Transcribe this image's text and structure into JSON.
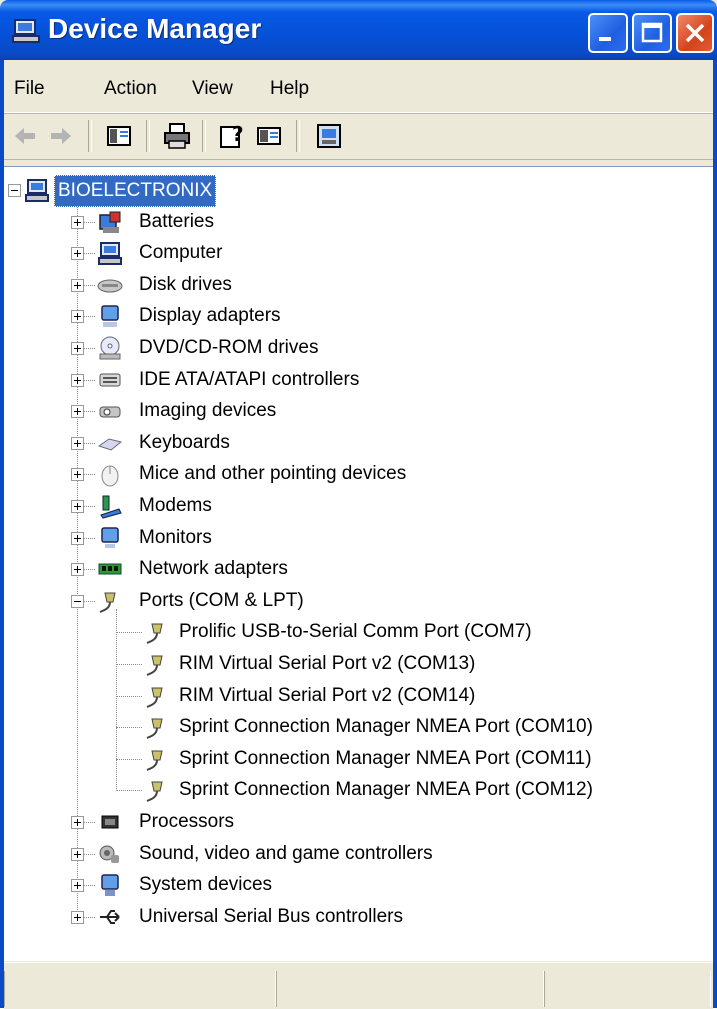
{
  "window": {
    "title": "Device Manager",
    "title_icon": "computer-icon",
    "controls": [
      "minimize",
      "maximize",
      "close"
    ],
    "accent_color": "#0a4ac6"
  },
  "menu": {
    "items": [
      "File",
      "Action",
      "View",
      "Help"
    ]
  },
  "toolbar": {
    "buttons": [
      {
        "name": "back-icon"
      },
      {
        "name": "forward-icon"
      },
      {
        "name": "show-hide-console-tree-icon"
      },
      {
        "name": "print-icon"
      },
      {
        "name": "help-icon"
      },
      {
        "name": "properties-icon"
      },
      {
        "name": "scan-hardware-icon"
      }
    ]
  },
  "tree": {
    "root": {
      "label": "BIOELECTRONIX",
      "icon": "computer-icon",
      "selected": true
    },
    "categories": [
      {
        "label": "Batteries",
        "icon": "battery-icon",
        "expanded": false
      },
      {
        "label": "Computer",
        "icon": "computer-icon",
        "expanded": false
      },
      {
        "label": "Disk drives",
        "icon": "disk-drive-icon",
        "expanded": false
      },
      {
        "label": "Display adapters",
        "icon": "display-adapter-icon",
        "expanded": false
      },
      {
        "label": "DVD/CD-ROM drives",
        "icon": "dvd-drive-icon",
        "expanded": false
      },
      {
        "label": "IDE ATA/ATAPI controllers",
        "icon": "ide-controller-icon",
        "expanded": false
      },
      {
        "label": "Imaging devices",
        "icon": "camera-icon",
        "expanded": false
      },
      {
        "label": "Keyboards",
        "icon": "keyboard-icon",
        "expanded": false
      },
      {
        "label": "Mice and other pointing devices",
        "icon": "mouse-icon",
        "expanded": false
      },
      {
        "label": "Modems",
        "icon": "modem-icon",
        "expanded": false
      },
      {
        "label": "Monitors",
        "icon": "monitor-icon",
        "expanded": false
      },
      {
        "label": "Network adapters",
        "icon": "network-adapter-icon",
        "expanded": false
      },
      {
        "label": "Ports (COM & LPT)",
        "icon": "port-icon",
        "expanded": true,
        "children": [
          "Prolific USB-to-Serial Comm Port (COM7)",
          "RIM Virtual Serial Port v2 (COM13)",
          "RIM Virtual Serial Port v2 (COM14)",
          "Sprint Connection Manager NMEA Port (COM10)",
          "Sprint Connection Manager NMEA Port (COM11)",
          "Sprint Connection Manager NMEA Port (COM12)"
        ]
      },
      {
        "label": "Processors",
        "icon": "processor-icon",
        "expanded": false
      },
      {
        "label": "Sound, video and game controllers",
        "icon": "sound-icon",
        "expanded": false
      },
      {
        "label": "System devices",
        "icon": "system-devices-icon",
        "expanded": false
      },
      {
        "label": "Universal Serial Bus controllers",
        "icon": "usb-icon",
        "expanded": false
      }
    ]
  }
}
